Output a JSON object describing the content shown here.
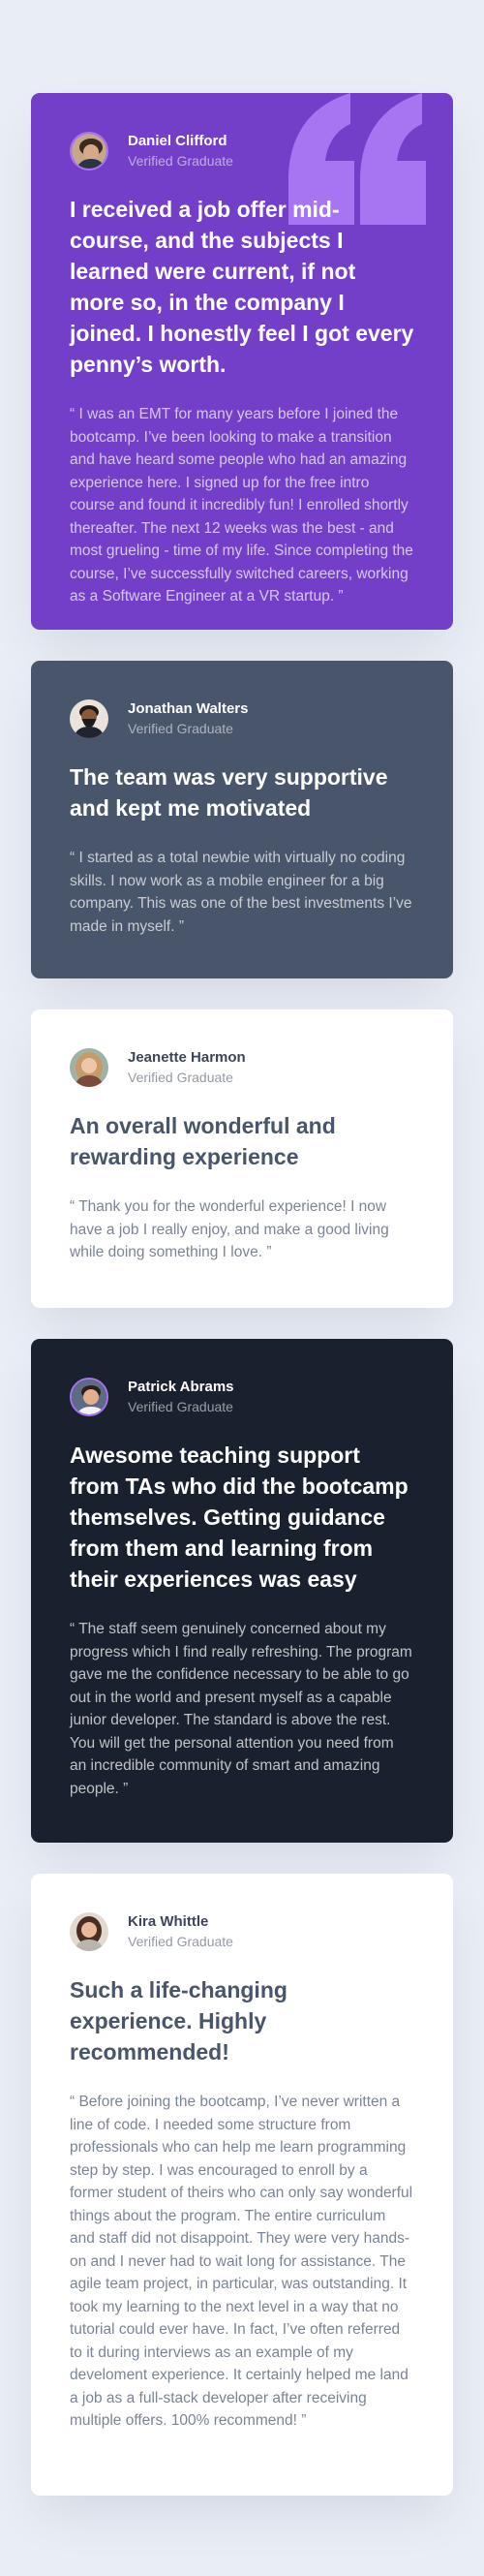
{
  "colors": {
    "page_background": "#e9edf5",
    "moderate_violet": "#733fc8",
    "grayish_blue": "#48556a",
    "blackish_blue": "#19212e",
    "white": "#ffffff",
    "light_violet": "#a775f1"
  },
  "testimonials": [
    {
      "name": "Daniel Clifford",
      "role": "Verified Graduate",
      "headline": "I received a job offer mid-course, and the subjects I learned were current, if not more so, in the company I joined. I honestly feel I got every penny’s worth.",
      "body": "“ I was an EMT for many years before I joined the bootcamp. I’ve been looking to make a transition and have heard some people who had an amazing experience here. I signed up for the free intro course and found it incredibly fun! I enrolled shortly thereafter. The next 12 weeks was the best - and most grueling - time of my life. Since completing the course, I’ve successfully switched careers, working as a Software Engineer at a VR startup. ”",
      "background": "#733fc8",
      "icon": "quotation-mark-icon"
    },
    {
      "name": "Jonathan Walters",
      "role": "Verified Graduate",
      "headline": "The team was very supportive and kept me motivated",
      "body": "“ I started as a total newbie with virtually no coding skills. I now work as a mobile engineer for a big company. This was one of the best investments I’ve made in myself. ”",
      "background": "#48556a"
    },
    {
      "name": "Jeanette Harmon",
      "role": "Verified Graduate",
      "headline": "An overall wonderful and rewarding experience",
      "body": "“ Thank you for the wonderful experience! I now have a job I really enjoy, and make a good living while doing something I love. ”",
      "background": "#ffffff"
    },
    {
      "name": "Patrick Abrams",
      "role": "Verified Graduate",
      "headline": "Awesome teaching support from TAs who did the bootcamp themselves. Getting guidance from them and learning from their experiences was easy",
      "body": "“ The staff seem genuinely concerned about my progress which I find really refreshing. The program gave me the confidence necessary to be able to go out in the world and present myself as a capable junior developer. The standard is above the rest. You will get the personal attention you need from an incredible community of smart and amazing people. ”",
      "background": "#19212e"
    },
    {
      "name": "Kira Whittle",
      "role": "Verified Graduate",
      "headline": "Such a life-changing experience. Highly recommended!",
      "body": "“ Before joining the bootcamp, I’ve never written a line of code. I needed some structure from professionals who can help me learn programming step by step. I was encouraged to enroll by a former student of theirs who can only say wonderful things about the program. The entire curriculum and staff did not disappoint. They were very hands-on and I never had to wait long for assistance. The agile team project, in particular, was outstanding. It took my learning to the next level in a way that no tutorial could ever have. In fact, I’ve often referred to it during interviews as an example of my develoment experience. It certainly helped me land a job as a full-stack developer after receiving multiple offers. 100% recommend! ”",
      "background": "#ffffff"
    }
  ]
}
